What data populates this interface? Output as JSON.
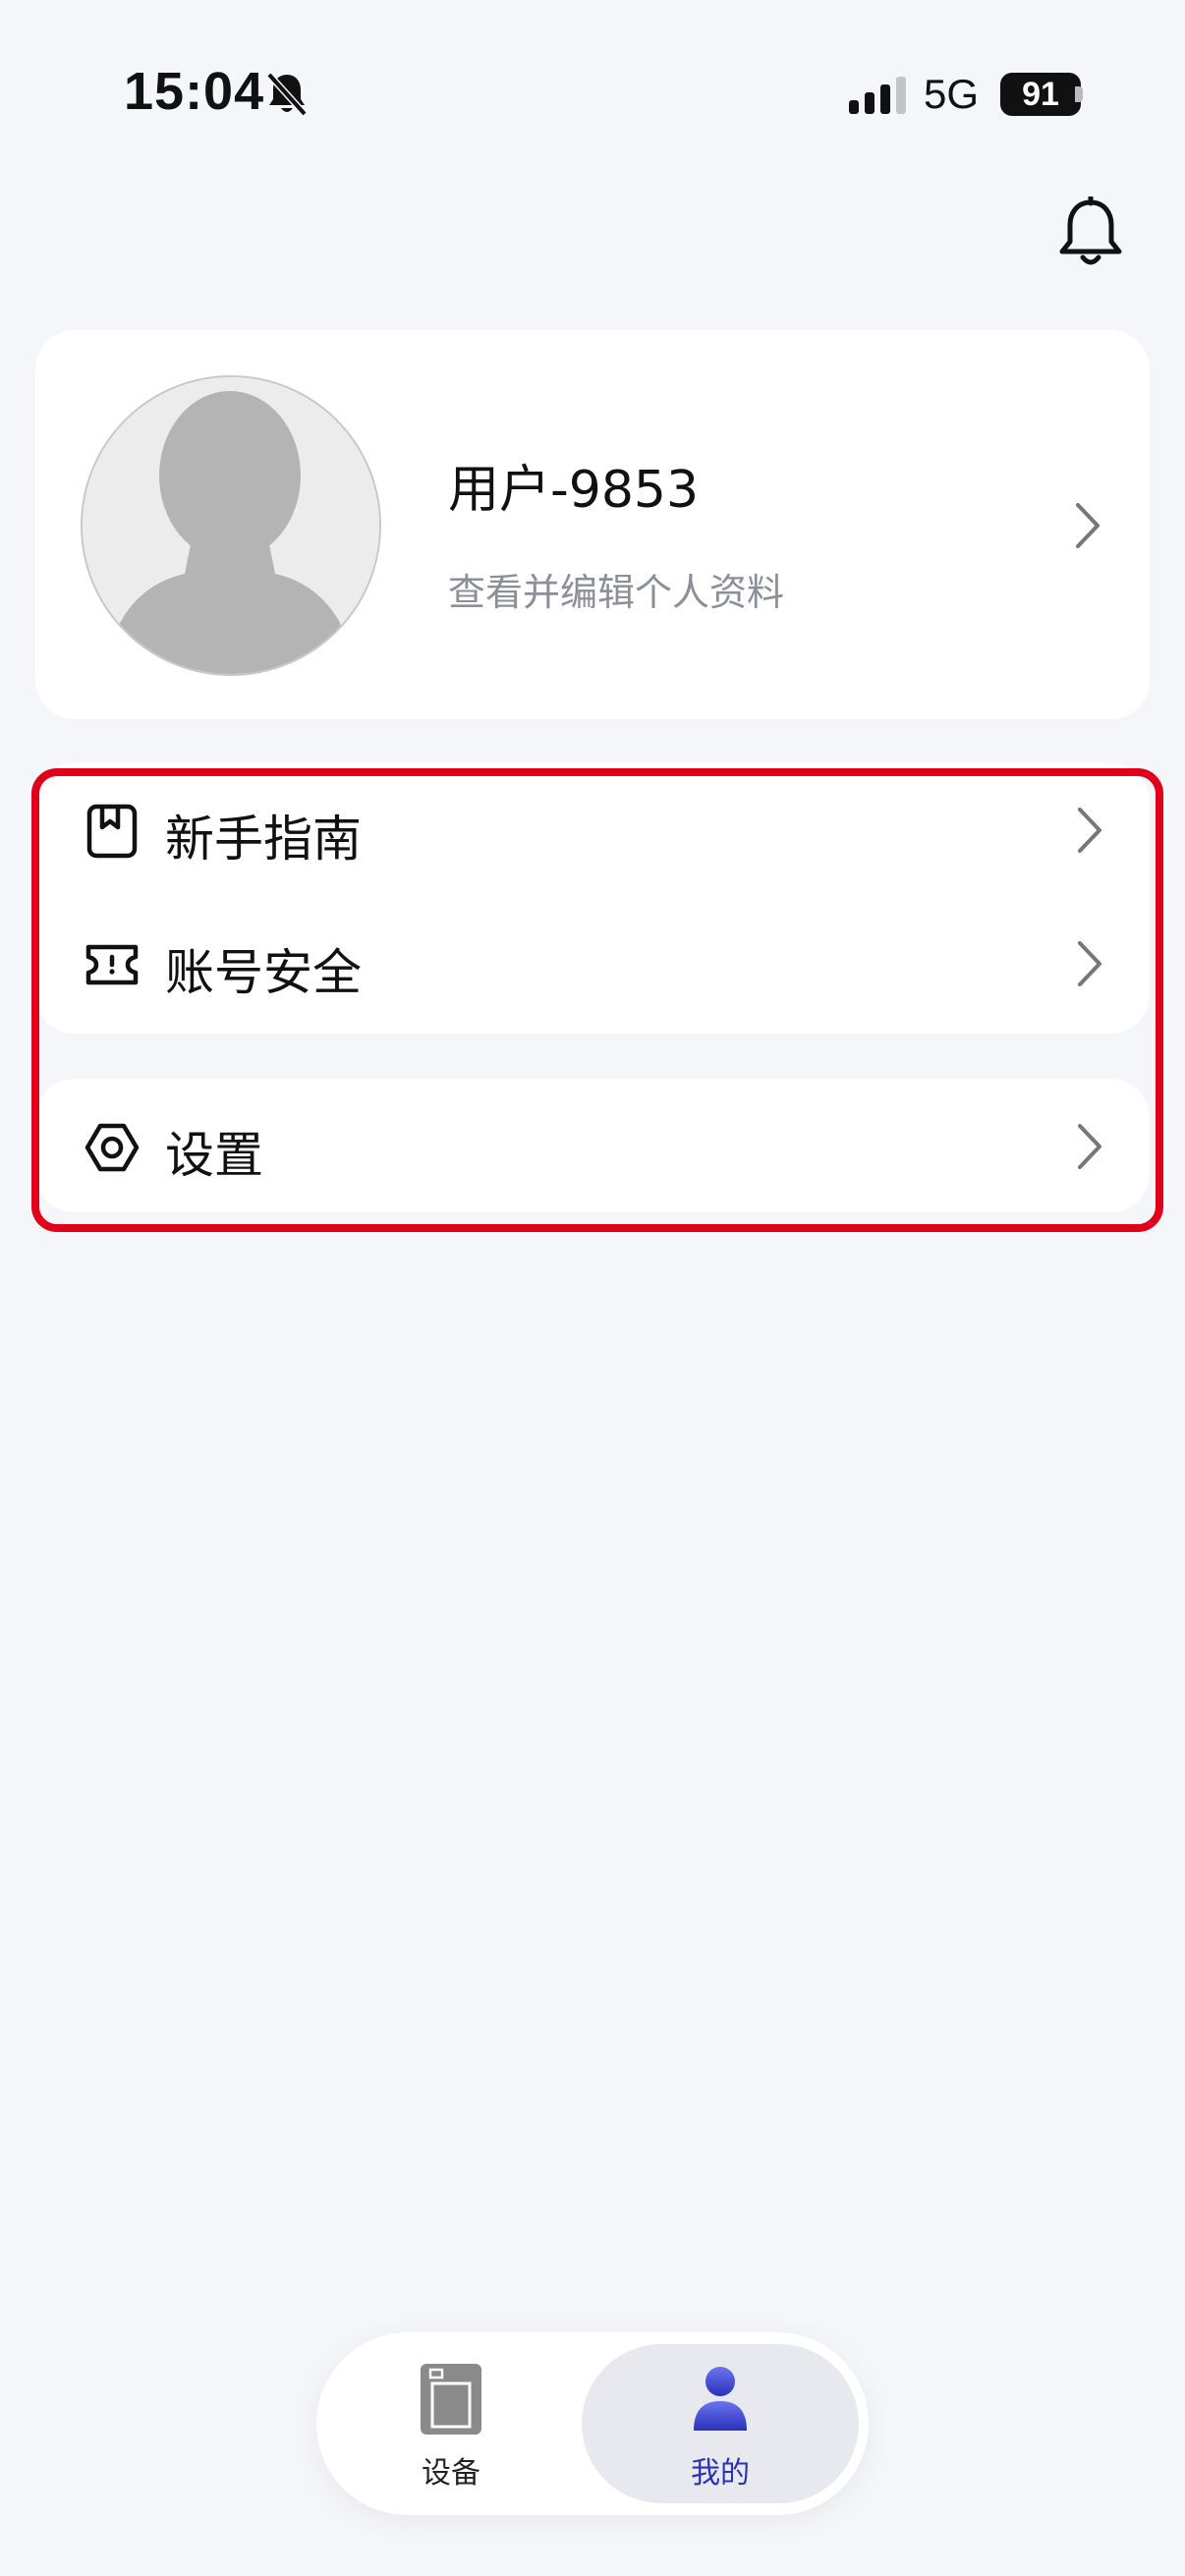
{
  "status_bar": {
    "time": "15:04",
    "network": "5G",
    "battery": "91"
  },
  "profile": {
    "name": "用户-9853",
    "subtitle": "查看并编辑个人资料"
  },
  "menu_group_1": {
    "items": [
      {
        "label": "新手指南",
        "icon": "guide-book-icon"
      },
      {
        "label": "账号安全",
        "icon": "ticket-icon"
      }
    ]
  },
  "menu_group_2": {
    "items": [
      {
        "label": "设置",
        "icon": "hexagon-gear-icon"
      }
    ]
  },
  "tab_bar": {
    "tabs": [
      {
        "label": "设备",
        "icon": "device-icon",
        "active": false
      },
      {
        "label": "我的",
        "icon": "person-icon",
        "active": true
      }
    ]
  },
  "colors": {
    "background": "#f5f6fa",
    "card": "#ffffff",
    "highlight": "#e0001a",
    "active_tab_text": "#2a32b8",
    "subtitle": "#8a8f99"
  }
}
